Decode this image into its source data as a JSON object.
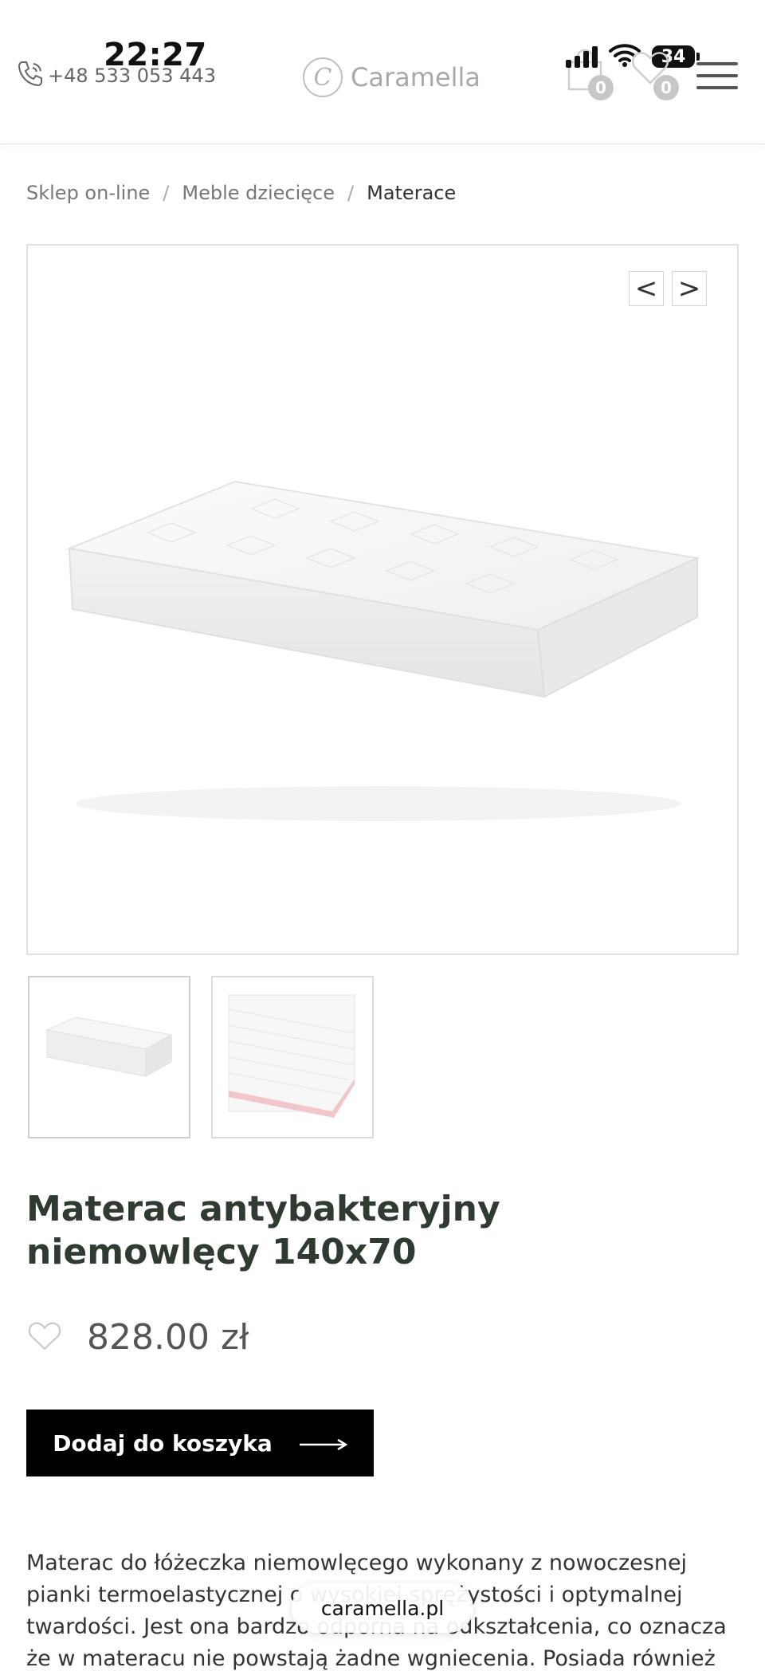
{
  "status_bar": {
    "time": "22:27",
    "battery": "34"
  },
  "header": {
    "phone": "+48 533 053 443",
    "logo_text": "Caramella",
    "logo_mark": "C",
    "cart_count": "0",
    "wishlist_count": "0"
  },
  "breadcrumb": {
    "items": [
      "Sklep on-line",
      "Meble dziecięce",
      "Materace"
    ],
    "separator": "/"
  },
  "gallery": {
    "prev_label": "<",
    "next_label": ">"
  },
  "product": {
    "title": "Materac antybakteryjny niemowlęcy 140x70",
    "price": "828.00 zł",
    "add_to_cart": "Dodaj do koszyka",
    "description": "Materac do łóżeczka niemowlęcego wykonany z nowoczesnej pianki termoelastycznej o wysokiej sprężystości i optymalnej twardości. Jest ona bardzo odporna na odkształcenia, co oznacza że w materacu nie powstają żadne wgniecenia. Posiada również"
  },
  "browser": {
    "url": "caramella.pl"
  },
  "colors": {
    "title": "#2f3a30",
    "button_bg": "#000000",
    "button_text": "#ffffff",
    "badge": "#c7c7c7"
  }
}
